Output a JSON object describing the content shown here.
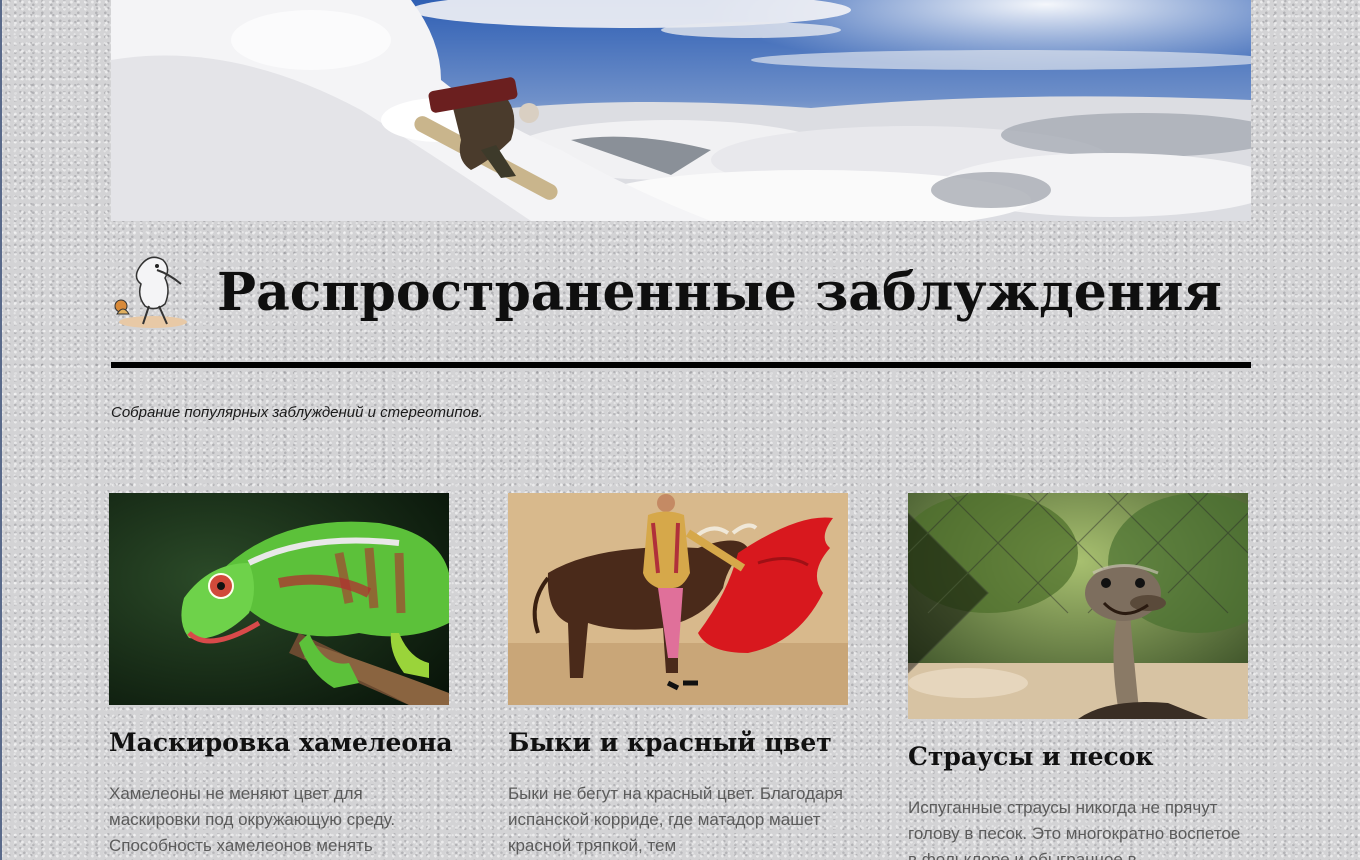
{
  "header": {
    "banner_image": "snowboarder-above-clouds",
    "logo_image": "ostrich-cartoon-logo",
    "site_title": "Распространенные заблуждения",
    "tagline": "Собрание популярных заблуждений и стереотипов."
  },
  "posts": [
    {
      "image": "chameleon-photo",
      "title": "Маскировка хамелеона",
      "excerpt": "Хамелеоны не меняют цвет для маскировки под окружающую среду. Способность хамелеонов менять"
    },
    {
      "image": "bullfight-photo",
      "title": "Быки и красный цвет",
      "excerpt": "Быки не бегут на красный цвет. Благодаря испанской корриде, где матадор машет красной тряпкой, тем"
    },
    {
      "image": "ostrich-photo",
      "title": "Страусы и песок",
      "excerpt": "Испуганные страусы никогда не прячут голову в песок. Это многократно воспетое в фольклоре и обыгранное в"
    }
  ],
  "colors": {
    "page_background": "#d3d3d5",
    "title_text": "#0f0f0f",
    "excerpt_text": "#5b5b5b",
    "rule": "#000000"
  }
}
